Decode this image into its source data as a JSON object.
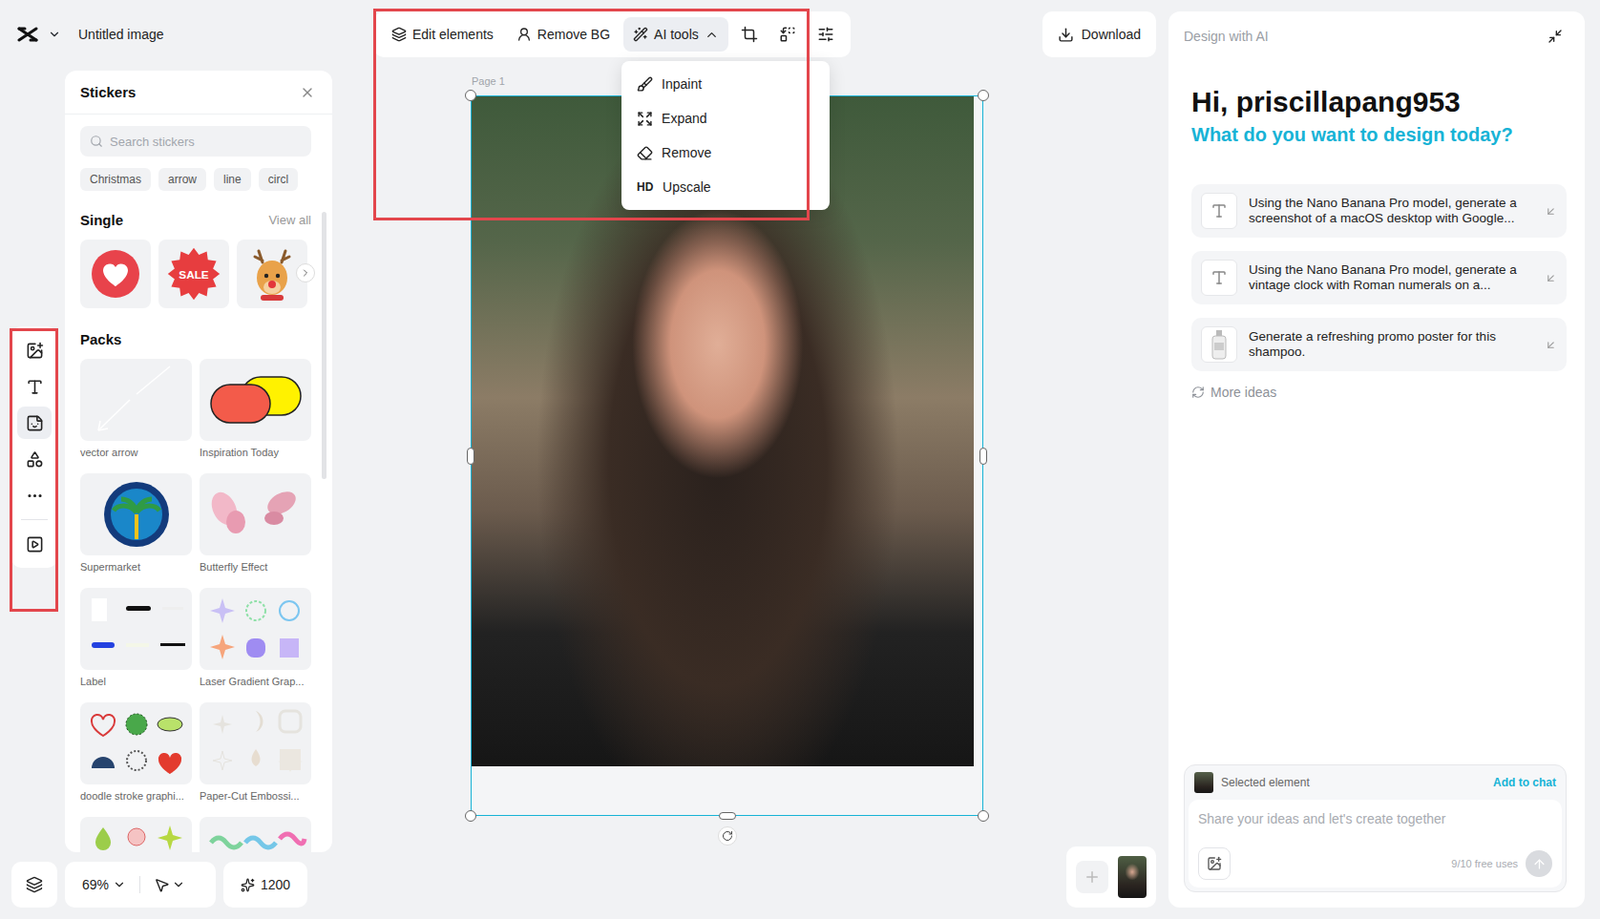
{
  "document": {
    "title": "Untitled image",
    "page_label": "Page 1"
  },
  "toolbar": [
    {
      "label": "Edit elements",
      "kind": "edit",
      "selected": false
    },
    {
      "label": "Remove BG",
      "kind": "remove-bg",
      "selected": false
    },
    {
      "label": "AI tools",
      "kind": "ai",
      "selected": true,
      "expanded": true
    }
  ],
  "ai_menu": [
    {
      "label": "Inpaint",
      "kind": "inpaint"
    },
    {
      "label": "Expand",
      "kind": "expand"
    },
    {
      "label": "Remove",
      "kind": "remove"
    },
    {
      "label": "Upscale",
      "kind": "upscale",
      "badge": "HD"
    }
  ],
  "download": "Download",
  "left_rail": [
    {
      "kind": "upload",
      "selected": false
    },
    {
      "kind": "text",
      "selected": false
    },
    {
      "kind": "sticker",
      "selected": true
    },
    {
      "kind": "shapes",
      "selected": false
    },
    {
      "kind": "more",
      "selected": false
    },
    {
      "kind": "video",
      "selected": false
    }
  ],
  "stickers": {
    "title": "Stickers",
    "search_placeholder": "Search stickers",
    "tags": [
      "Christmas",
      "arrow",
      "line",
      "circl"
    ],
    "single_title": "Single",
    "view_all": "View all",
    "single": [
      {
        "kind": "heart"
      },
      {
        "kind": "sale",
        "text": "SALE"
      },
      {
        "kind": "reindeer"
      }
    ],
    "packs_title": "Packs",
    "packs": [
      {
        "label": "vector arrow",
        "kind": "arrow"
      },
      {
        "label": "Inspiration Today",
        "kind": "pill"
      },
      {
        "label": "Supermarket",
        "kind": "badge"
      },
      {
        "label": "Butterfly Effect",
        "kind": "butterfly"
      },
      {
        "label": "Label",
        "kind": "labels"
      },
      {
        "label": "Laser Gradient Grap...",
        "kind": "gradient"
      },
      {
        "label": "doodle stroke graphi...",
        "kind": "doodle"
      },
      {
        "label": "Paper-Cut Embossi...",
        "kind": "papercut"
      },
      {
        "kind": "drops"
      },
      {
        "kind": "waves"
      }
    ]
  },
  "zoom": "69%",
  "credits": "1200",
  "assistant": {
    "title": "Design with AI",
    "greeting": "Hi, priscillapang953",
    "prompt": "What do you want to design today?",
    "suggestions": [
      {
        "kind": "text",
        "text": "Using the Nano Banana Pro model, generate a screenshot of a macOS desktop with Google..."
      },
      {
        "kind": "text",
        "text": "Using the Nano Banana Pro model, generate a vintage clock with Roman numerals on a..."
      },
      {
        "kind": "image",
        "text": "Generate a refreshing promo poster for this shampoo."
      }
    ],
    "more_ideas": "More ideas",
    "selected_label": "Selected element",
    "add_to_chat": "Add to chat",
    "input_placeholder": "Share your ideas and let's create together",
    "usage": "9/10 free uses"
  }
}
